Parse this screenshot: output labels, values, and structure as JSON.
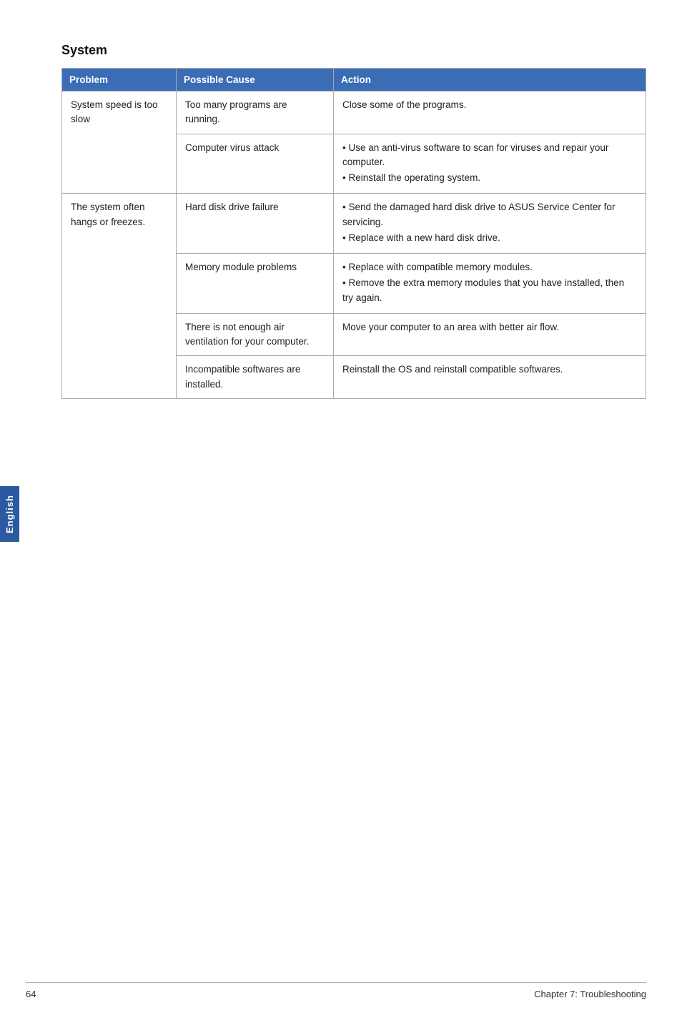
{
  "side_tab": {
    "label": "English"
  },
  "section": {
    "title": "System"
  },
  "table": {
    "headers": [
      "Problem",
      "Possible Cause",
      "Action"
    ],
    "rows": [
      {
        "problem": "System speed is too slow",
        "cause": "Too many programs are running.",
        "action_type": "plain",
        "action": "Close some of the programs."
      },
      {
        "problem": "",
        "cause": "Computer virus attack",
        "action_type": "bullets",
        "action_bullets": [
          "Use an anti-virus software to scan for viruses and repair your computer.",
          "Reinstall the operating system."
        ]
      },
      {
        "problem": "The system often hangs or freezes.",
        "cause": "Hard disk drive failure",
        "action_type": "bullets",
        "action_bullets": [
          "Send the damaged hard disk drive to ASUS Service Center for servicing.",
          "Replace with a new hard disk drive."
        ]
      },
      {
        "problem": "",
        "cause": "Memory module problems",
        "action_type": "bullets",
        "action_bullets": [
          "Replace with compatible memory modules.",
          "Remove the extra memory modules that you have installed, then try again."
        ]
      },
      {
        "problem": "",
        "cause": "There is not enough air ventilation for your computer.",
        "action_type": "plain",
        "action": "Move your computer to an area with better air flow."
      },
      {
        "problem": "",
        "cause": "Incompatible softwares are installed.",
        "action_type": "plain",
        "action": "Reinstall the OS and reinstall compatible softwares."
      }
    ]
  },
  "footer": {
    "page_number": "64",
    "chapter": "Chapter 7: Troubleshooting"
  }
}
